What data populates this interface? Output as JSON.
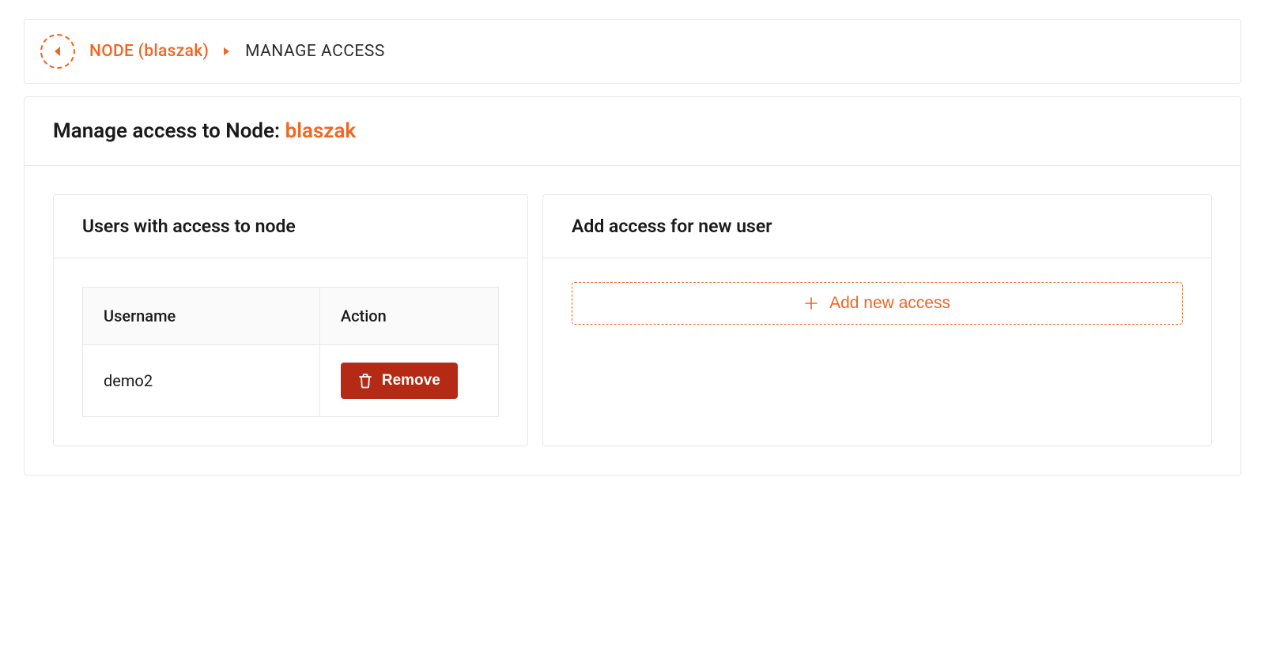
{
  "breadcrumb": {
    "node_label": "NODE (blaszak)",
    "current": "MANAGE ACCESS"
  },
  "page_title": {
    "prefix": "Manage access to Node: ",
    "node_name": "blaszak"
  },
  "users_card": {
    "title": "Users with access to node",
    "columns": {
      "username": "Username",
      "action": "Action"
    },
    "rows": [
      {
        "username": "demo2",
        "remove_label": "Remove"
      }
    ]
  },
  "add_card": {
    "title": "Add access for new user",
    "button_label": "Add new access"
  },
  "colors": {
    "accent": "#f26522",
    "danger": "#b52a14"
  }
}
